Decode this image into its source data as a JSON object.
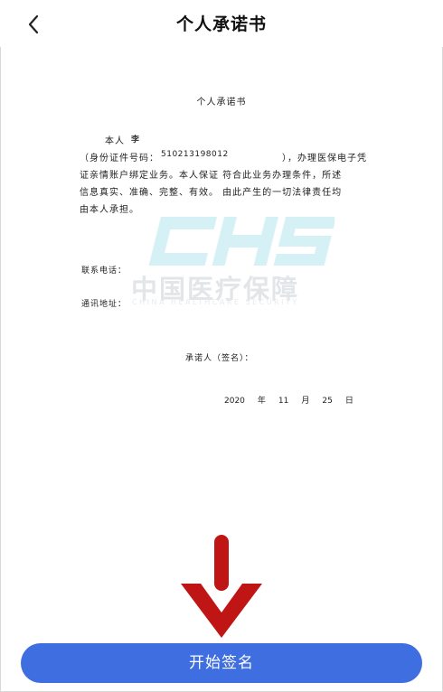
{
  "header": {
    "title": "个人承诺书",
    "back_icon": "chevron-left-icon"
  },
  "document": {
    "title": "个人承诺书",
    "name_label": "本人",
    "name_value": "李",
    "id_open": "（身份证件号码：",
    "id_number": "510213198012",
    "id_close": "），办理医保电子凭",
    "body_line_2": "证亲情账户绑定业务。本人保证  符合此业务办理条件，所述",
    "body_line_3": "信息真实、准确、完整、有效。  由此产生的一切法律责任均",
    "body_line_4": "由本人承担。",
    "phone_label": "联系电话：",
    "address_label": "通讯地址：",
    "signer_label": "承诺人（签名）：",
    "date": {
      "year": "2020",
      "year_unit": "年",
      "month": "11",
      "month_unit": "月",
      "day": "25",
      "day_unit": "日"
    }
  },
  "watermark": {
    "logo": "CHS",
    "name": "中国医疗保障",
    "english": "CHINA HEALTHCARE SECURITY",
    "color": "#d9f3f6"
  },
  "arrow": {
    "icon": "down-arrow-icon",
    "color": "#c01515"
  },
  "footer": {
    "button_label": "开始签名",
    "button_color": "#3f6ee0"
  }
}
